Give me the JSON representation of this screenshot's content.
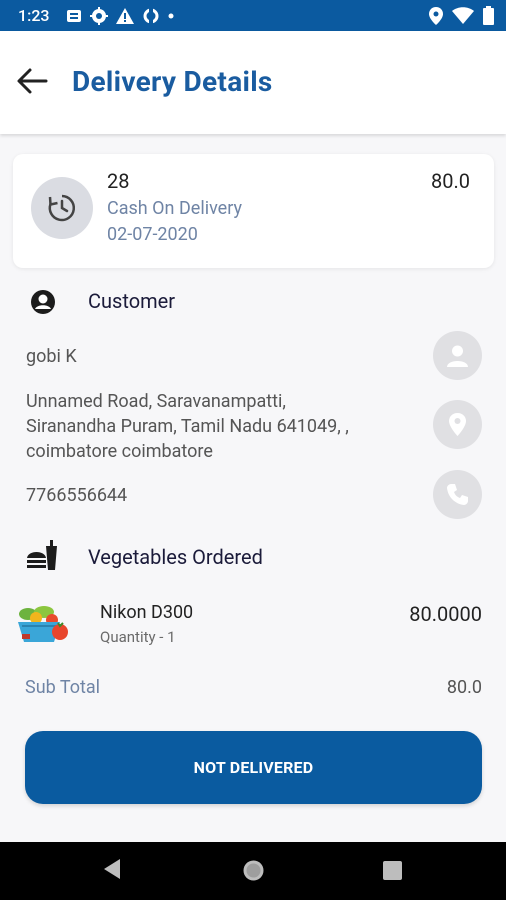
{
  "status_bar": {
    "time": "1:23",
    "icons": [
      "notification-icon",
      "settings-icon",
      "warning-icon",
      "sync-icon",
      "dot-icon",
      "location-icon",
      "wifi-icon",
      "battery-icon"
    ]
  },
  "header": {
    "title": "Delivery Details",
    "back_icon": "back-arrow-icon"
  },
  "order": {
    "id": "28",
    "payment_method": "Cash On Delivery",
    "date": "02-07-2020",
    "amount": "80.0"
  },
  "customer": {
    "section_title": "Customer",
    "name": "gobi  K",
    "address_line1": "Unnamed Road, Saravanampatti,",
    "address_line2": "Siranandha Puram, Tamil Nadu 641049, ,",
    "address_line3": "coimbatore coimbatore",
    "phone": "7766556644"
  },
  "items": {
    "section_title": "Vegetables Ordered",
    "list": [
      {
        "name": "Nikon D300",
        "quantity": "Quantity - 1",
        "price": "80.0000"
      }
    ]
  },
  "summary": {
    "subtotal_label": "Sub Total",
    "subtotal_value": "80.0"
  },
  "action": {
    "label": "NOT DELIVERED"
  },
  "colors": {
    "primary": "#0b5aa0",
    "title": "#1a5ca0",
    "muted_blue": "#6f84a5",
    "background": "#f7f7f9"
  }
}
